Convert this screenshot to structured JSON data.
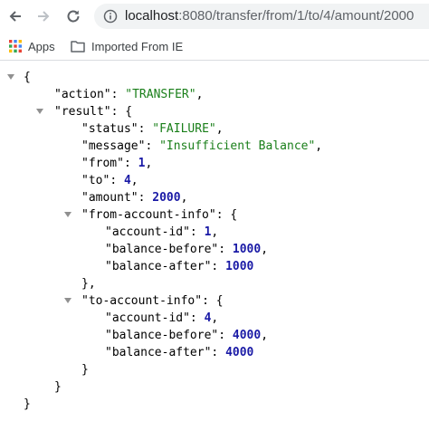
{
  "browser": {
    "url_host": "localhost",
    "url_path": ":8080/transfer/from/1/to/4/amount/2000"
  },
  "bookmarks": [
    {
      "label": "Apps",
      "icon": "apps-grid-icon"
    },
    {
      "label": "Imported From IE",
      "icon": "folder-icon"
    }
  ],
  "response": {
    "action_key": "\"action\"",
    "action_value": "\"TRANSFER\"",
    "result_key": "\"result\"",
    "status_key": "\"status\"",
    "status_value": "\"FAILURE\"",
    "message_key": "\"message\"",
    "message_value": "\"Insufficient Balance\"",
    "from_key": "\"from\"",
    "from_value": "1",
    "to_key": "\"to\"",
    "to_value": "4",
    "amount_key": "\"amount\"",
    "amount_value": "2000",
    "from_info_key": "\"from-account-info\"",
    "from_info": {
      "account_id_key": "\"account-id\"",
      "account_id_value": "1",
      "balance_before_key": "\"balance-before\"",
      "balance_before_value": "1000",
      "balance_after_key": "\"balance-after\"",
      "balance_after_value": "1000"
    },
    "to_info_key": "\"to-account-info\"",
    "to_info": {
      "account_id_key": "\"account-id\"",
      "account_id_value": "4",
      "balance_before_key": "\"balance-before\"",
      "balance_before_value": "4000",
      "balance_after_key": "\"balance-after\"",
      "balance_after_value": "4000"
    }
  },
  "colors": {
    "string": "#1a7f1a",
    "number": "#1a1aa6",
    "toggle": "#909090"
  }
}
